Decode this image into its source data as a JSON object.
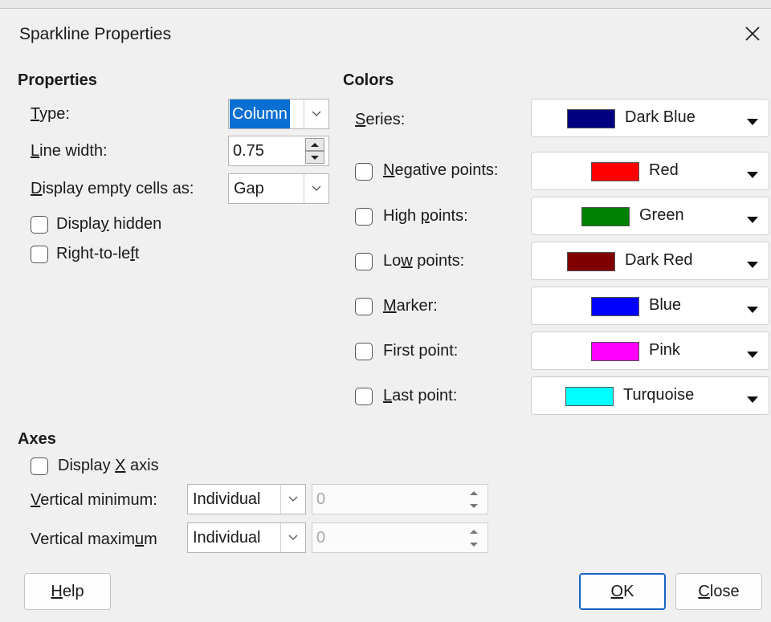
{
  "dialog": {
    "title": "Sparkline Properties"
  },
  "properties": {
    "heading": "Properties",
    "type_label": {
      "pre": "",
      "u": "T",
      "post": "ype:"
    },
    "type_value": "Column",
    "line_width_label": {
      "pre": "",
      "u": "L",
      "post": "ine width:"
    },
    "line_width_value": "0.75",
    "empty_label": {
      "pre": "",
      "u": "D",
      "post": "isplay empty cells as:"
    },
    "empty_value": "Gap",
    "display_hidden": {
      "pre": "Displa",
      "u": "y",
      "post": " hidden",
      "checked": false
    },
    "rtl": {
      "pre": "Right-to-le",
      "u": "f",
      "post": "t",
      "checked": false
    }
  },
  "colors": {
    "heading": "Colors",
    "series": {
      "pre": "",
      "u": "S",
      "post": "eries:",
      "color_name": "Dark Blue",
      "hex": "#000080"
    },
    "negative": {
      "pre": "",
      "u": "N",
      "post": "egative points:",
      "color_name": "Red",
      "hex": "#ff0000",
      "checked": false
    },
    "high": {
      "pre": "High ",
      "u": "p",
      "post": "oints:",
      "color_name": "Green",
      "hex": "#008000",
      "checked": false
    },
    "low": {
      "pre": "Lo",
      "u": "w",
      "post": " points:",
      "color_name": "Dark Red",
      "hex": "#800000",
      "checked": false
    },
    "marker": {
      "pre": "",
      "u": "M",
      "post": "arker:",
      "color_name": "Blue",
      "hex": "#0000ff",
      "checked": false
    },
    "first": {
      "pre": "First point:",
      "u": "",
      "post": "",
      "color_name": "Pink",
      "hex": "#ff00ff",
      "checked": false
    },
    "last": {
      "pre": "",
      "u": "L",
      "post": "ast point:",
      "color_name": "Turquoise",
      "hex": "#00ffff",
      "checked": false
    }
  },
  "axes": {
    "heading": "Axes",
    "display_x": {
      "pre": "Display ",
      "u": "X",
      "post": " axis",
      "checked": false
    },
    "vmin_label": {
      "pre": "",
      "u": "V",
      "post": "ertical minimum:"
    },
    "vmin_mode": "Individual",
    "vmin_value": "0",
    "vmax_label": {
      "pre": "Vertical maxim",
      "u": "u",
      "post": "m"
    },
    "vmax_mode": "Individual",
    "vmax_value": "0"
  },
  "buttons": {
    "help": {
      "pre": "",
      "u": "H",
      "post": "elp"
    },
    "ok": {
      "pre": "",
      "u": "O",
      "post": "K"
    },
    "close": {
      "pre": "",
      "u": "C",
      "post": "lose"
    }
  }
}
